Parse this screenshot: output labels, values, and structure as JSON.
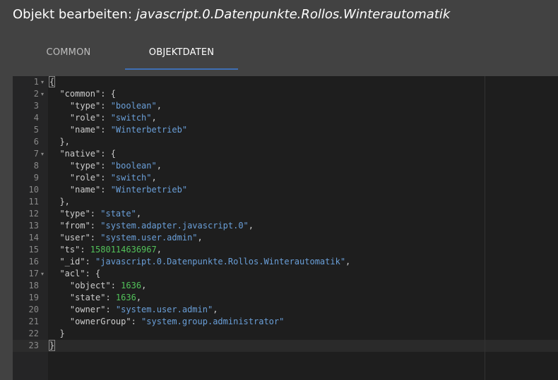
{
  "dialog": {
    "title_prefix": "Objekt bearbeiten:",
    "title_path": "javascript.0.Datenpunkte.Rollos.Winterautomatik"
  },
  "tabs": [
    {
      "label": "COMMON",
      "active": false
    },
    {
      "label": "OBJEKTDATEN",
      "active": true
    }
  ],
  "colors": {
    "accent": "#3f6fb5",
    "string": "#6a9fd8",
    "number": "#52c25a",
    "text": "#cccccc"
  },
  "editor": {
    "active_line": 23,
    "fold_lines": [
      1,
      2,
      7,
      17
    ],
    "lines": [
      [
        {
          "t": "{",
          "c": "p"
        }
      ],
      [
        {
          "t": "  \"common\": {",
          "c": "p"
        }
      ],
      [
        {
          "t": "    \"type\": ",
          "c": "p"
        },
        {
          "t": "\"boolean\"",
          "c": "s"
        },
        {
          "t": ",",
          "c": "p"
        }
      ],
      [
        {
          "t": "    \"role\": ",
          "c": "p"
        },
        {
          "t": "\"switch\"",
          "c": "s"
        },
        {
          "t": ",",
          "c": "p"
        }
      ],
      [
        {
          "t": "    \"name\": ",
          "c": "p"
        },
        {
          "t": "\"Winterbetrieb\"",
          "c": "s"
        }
      ],
      [
        {
          "t": "  },",
          "c": "p"
        }
      ],
      [
        {
          "t": "  \"native\": {",
          "c": "p"
        }
      ],
      [
        {
          "t": "    \"type\": ",
          "c": "p"
        },
        {
          "t": "\"boolean\"",
          "c": "s"
        },
        {
          "t": ",",
          "c": "p"
        }
      ],
      [
        {
          "t": "    \"role\": ",
          "c": "p"
        },
        {
          "t": "\"switch\"",
          "c": "s"
        },
        {
          "t": ",",
          "c": "p"
        }
      ],
      [
        {
          "t": "    \"name\": ",
          "c": "p"
        },
        {
          "t": "\"Winterbetrieb\"",
          "c": "s"
        }
      ],
      [
        {
          "t": "  },",
          "c": "p"
        }
      ],
      [
        {
          "t": "  \"type\": ",
          "c": "p"
        },
        {
          "t": "\"state\"",
          "c": "s"
        },
        {
          "t": ",",
          "c": "p"
        }
      ],
      [
        {
          "t": "  \"from\": ",
          "c": "p"
        },
        {
          "t": "\"system.adapter.javascript.0\"",
          "c": "s"
        },
        {
          "t": ",",
          "c": "p"
        }
      ],
      [
        {
          "t": "  \"user\": ",
          "c": "p"
        },
        {
          "t": "\"system.user.admin\"",
          "c": "s"
        },
        {
          "t": ",",
          "c": "p"
        }
      ],
      [
        {
          "t": "  \"ts\": ",
          "c": "p"
        },
        {
          "t": "1580114636967",
          "c": "n"
        },
        {
          "t": ",",
          "c": "p"
        }
      ],
      [
        {
          "t": "  \"_id\": ",
          "c": "p"
        },
        {
          "t": "\"javascript.0.Datenpunkte.Rollos.Winterautomatik\"",
          "c": "s"
        },
        {
          "t": ",",
          "c": "p"
        }
      ],
      [
        {
          "t": "  \"acl\": {",
          "c": "p"
        }
      ],
      [
        {
          "t": "    \"object\": ",
          "c": "p"
        },
        {
          "t": "1636",
          "c": "n"
        },
        {
          "t": ",",
          "c": "p"
        }
      ],
      [
        {
          "t": "    \"state\": ",
          "c": "p"
        },
        {
          "t": "1636",
          "c": "n"
        },
        {
          "t": ",",
          "c": "p"
        }
      ],
      [
        {
          "t": "    \"owner\": ",
          "c": "p"
        },
        {
          "t": "\"system.user.admin\"",
          "c": "s"
        },
        {
          "t": ",",
          "c": "p"
        }
      ],
      [
        {
          "t": "    \"ownerGroup\": ",
          "c": "p"
        },
        {
          "t": "\"system.group.administrator\"",
          "c": "s"
        }
      ],
      [
        {
          "t": "  }",
          "c": "p"
        }
      ],
      [
        {
          "t": "}",
          "c": "p"
        }
      ]
    ]
  }
}
